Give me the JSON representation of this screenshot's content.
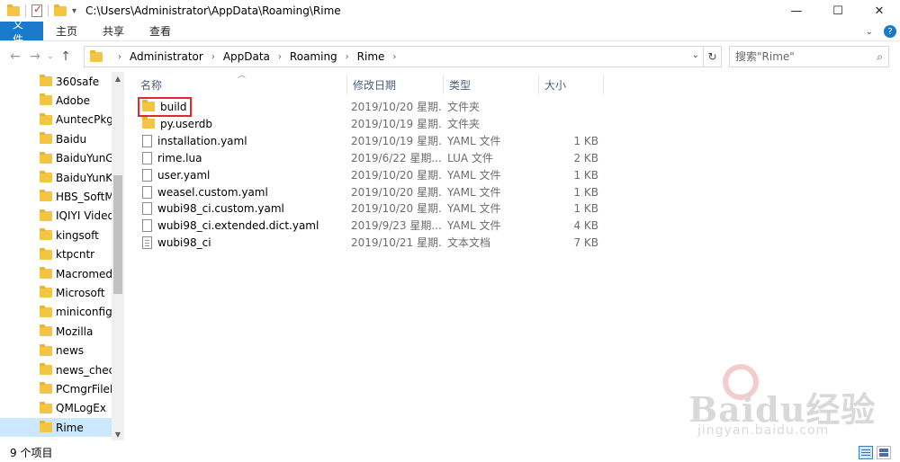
{
  "window": {
    "title_path": "C:\\Users\\Administrator\\AppData\\Roaming\\Rime",
    "minimize_icon": "minimize-icon",
    "maximize_icon": "maximize-icon",
    "close_icon": "close-icon"
  },
  "ribbon": {
    "tabs": [
      {
        "label": "文件",
        "active": true
      },
      {
        "label": "主页",
        "active": false
      },
      {
        "label": "共享",
        "active": false
      },
      {
        "label": "查看",
        "active": false
      }
    ],
    "help_glyph": "?"
  },
  "address": {
    "crumbs": [
      "Administrator",
      "AppData",
      "Roaming",
      "Rime"
    ]
  },
  "search": {
    "placeholder": "搜索\"Rime\""
  },
  "sidebar": {
    "items": [
      {
        "label": "360safe",
        "selected": false
      },
      {
        "label": "Adobe",
        "selected": false
      },
      {
        "label": "AuntecPkg",
        "selected": false
      },
      {
        "label": "Baidu",
        "selected": false
      },
      {
        "label": "BaiduYunGu",
        "selected": false
      },
      {
        "label": "BaiduYunKe",
        "selected": false
      },
      {
        "label": "HBS_SoftMg",
        "selected": false
      },
      {
        "label": "IQIYI Video",
        "selected": false
      },
      {
        "label": "kingsoft",
        "selected": false
      },
      {
        "label": "ktpcntr",
        "selected": false
      },
      {
        "label": "Macromedia",
        "selected": false
      },
      {
        "label": "Microsoft",
        "selected": false
      },
      {
        "label": "miniconfig",
        "selected": false
      },
      {
        "label": "Mozilla",
        "selected": false
      },
      {
        "label": "news",
        "selected": false
      },
      {
        "label": "news_check",
        "selected": false
      },
      {
        "label": "PCmgrFileRe",
        "selected": false
      },
      {
        "label": "QMLogEx",
        "selected": false
      },
      {
        "label": "Rime",
        "selected": true
      }
    ]
  },
  "columns": {
    "name": "名称",
    "date": "修改日期",
    "type": "类型",
    "size": "大小"
  },
  "files": [
    {
      "name": "build",
      "date": "2019/10/20 星期...",
      "type": "文件夹",
      "size": "",
      "icon": "folder"
    },
    {
      "name": "py.userdb",
      "date": "2019/10/19 星期...",
      "type": "文件夹",
      "size": "",
      "icon": "folder"
    },
    {
      "name": "installation.yaml",
      "date": "2019/10/19 星期...",
      "type": "YAML 文件",
      "size": "1 KB",
      "icon": "file"
    },
    {
      "name": "rime.lua",
      "date": "2019/6/22 星期...",
      "type": "LUA 文件",
      "size": "2 KB",
      "icon": "file"
    },
    {
      "name": "user.yaml",
      "date": "2019/10/20 星期...",
      "type": "YAML 文件",
      "size": "1 KB",
      "icon": "file"
    },
    {
      "name": "weasel.custom.yaml",
      "date": "2019/10/20 星期...",
      "type": "YAML 文件",
      "size": "1 KB",
      "icon": "file"
    },
    {
      "name": "wubi98_ci.custom.yaml",
      "date": "2019/10/20 星期...",
      "type": "YAML 文件",
      "size": "1 KB",
      "icon": "file"
    },
    {
      "name": "wubi98_ci.extended.dict.yaml",
      "date": "2019/9/23 星期...",
      "type": "YAML 文件",
      "size": "4 KB",
      "icon": "file"
    },
    {
      "name": "wubi98_ci",
      "date": "2019/10/21 星期...",
      "type": "文本文档",
      "size": "7 KB",
      "icon": "text-file"
    }
  ],
  "status": {
    "count_text": "9 个项目"
  },
  "watermark": {
    "brand": "Baidu经验",
    "url": "jingyan.baidu.com"
  }
}
